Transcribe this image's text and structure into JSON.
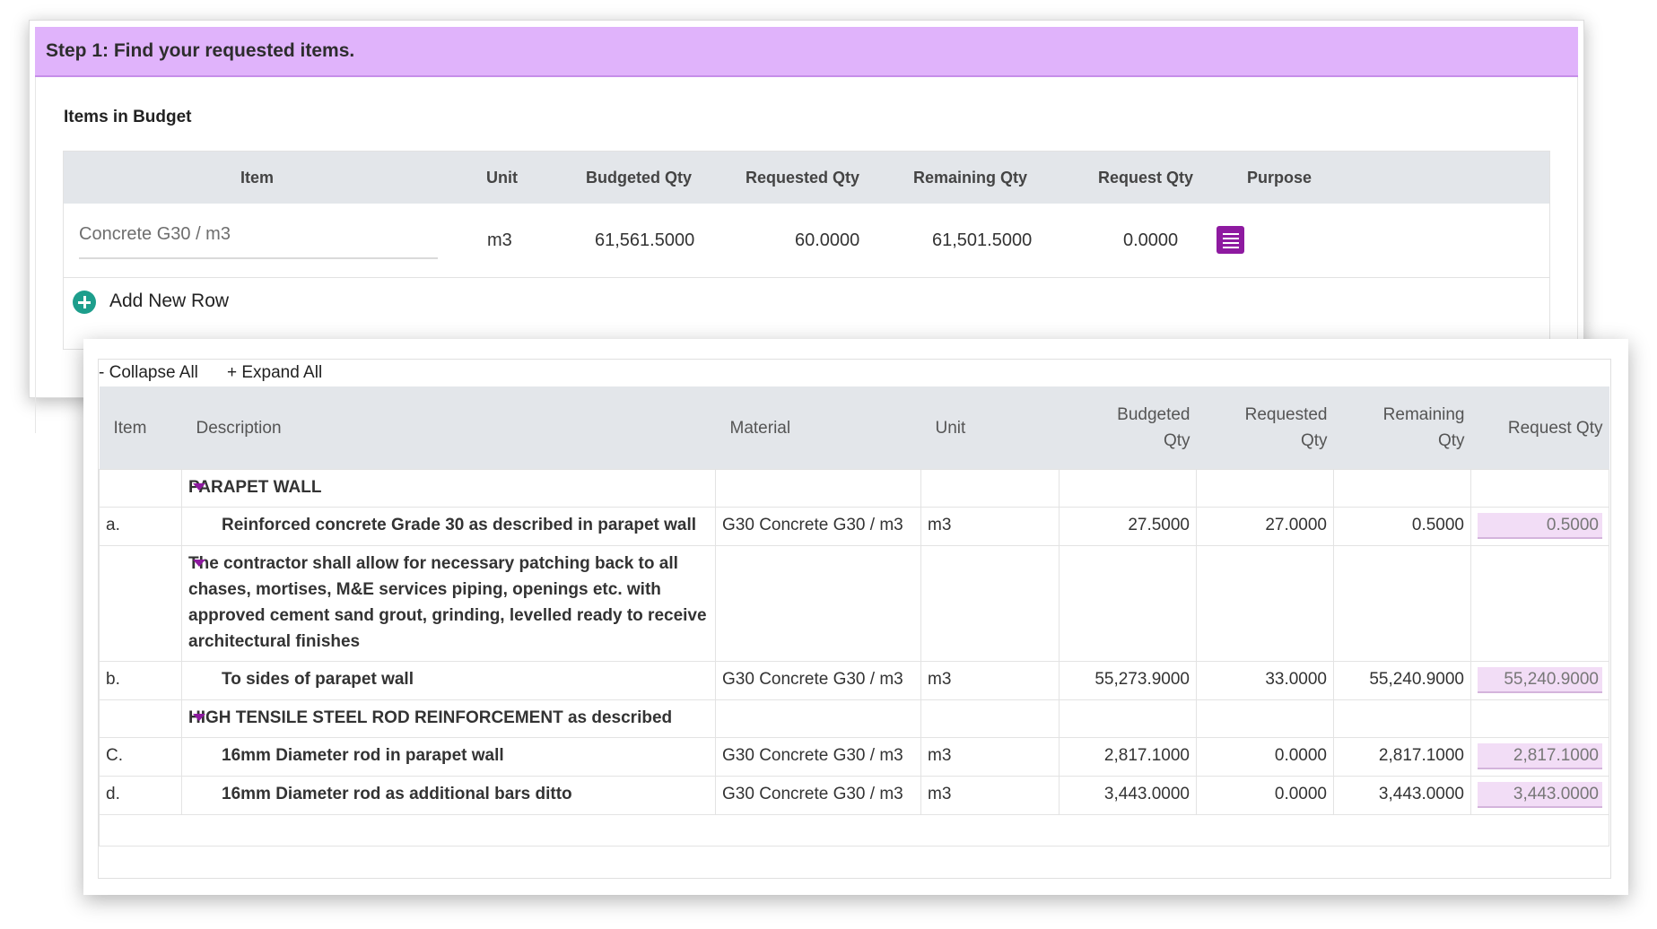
{
  "step": {
    "title": "Step 1: Find your requested items."
  },
  "budget": {
    "section_title": "Items in Budget",
    "columns": [
      "Item",
      "Unit",
      "Budgeted Qty",
      "Requested Qty",
      "Remaining Qty",
      "Request Qty",
      "Purpose"
    ],
    "row": {
      "item": "Concrete G30 / m3",
      "unit": "m3",
      "budgeted_qty": "61,561.5000",
      "requested_qty": "60.0000",
      "remaining_qty": "61,501.5000",
      "request_qty": "0.0000",
      "list_icon": "list-icon"
    },
    "add_row_label": "Add New Row",
    "add_icon": "plus-circle-icon",
    "accent": "#8e1aa0",
    "header_color": "#e0b3fb"
  },
  "tree": {
    "collapse_all": "- Collapse All",
    "expand_all": "+ Expand All",
    "columns": {
      "item": "Item",
      "description": "Description",
      "material": "Material",
      "unit": "Unit",
      "budgeted_qty_1": "Budgeted",
      "budgeted_qty_2": "Qty",
      "requested_qty_1": "Requested",
      "requested_qty_2": "Qty",
      "remaining_qty_1": "Remaining",
      "remaining_qty_2": "Qty",
      "request_qty": "Request Qty"
    },
    "rows": [
      {
        "type": "group",
        "description": "PARAPET WALL"
      },
      {
        "type": "item",
        "item": "a.",
        "description": "Reinforced concrete Grade 30 as described in parapet wall",
        "material": "G30 Concrete G30 / m3",
        "unit": "m3",
        "budgeted": "27.5000",
        "requested": "27.0000",
        "remaining": "0.5000",
        "request": "0.5000"
      },
      {
        "type": "group",
        "description": "The contractor shall allow for necessary patching back to all chases, mortises, M&E services piping, openings etc. with approved cement sand grout, grinding, levelled ready to receive architectural finishes"
      },
      {
        "type": "item",
        "item": "b.",
        "description": "To sides of parapet wall",
        "material": "G30 Concrete G30 / m3",
        "unit": "m3",
        "budgeted": "55,273.9000",
        "requested": "33.0000",
        "remaining": "55,240.9000",
        "request": "55,240.9000"
      },
      {
        "type": "group",
        "description": "HIGH TENSILE STEEL ROD REINFORCEMENT as described"
      },
      {
        "type": "item",
        "item": "C.",
        "description": "16mm Diameter rod in parapet wall",
        "material": "G30 Concrete G30 / m3",
        "unit": "m3",
        "budgeted": "2,817.1000",
        "requested": "0.0000",
        "remaining": "2,817.1000",
        "request": "2,817.1000"
      },
      {
        "type": "item",
        "item": "d.",
        "description": "16mm Diameter rod as additional bars ditto",
        "material": "G30 Concrete G30 / m3",
        "unit": "m3",
        "budgeted": "3,443.0000",
        "requested": "0.0000",
        "remaining": "3,443.0000",
        "request": "3,443.0000"
      }
    ]
  }
}
